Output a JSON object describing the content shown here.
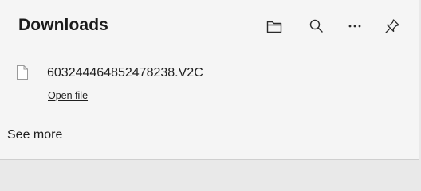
{
  "panel": {
    "title": "Downloads",
    "toolbar": [
      {
        "name": "open-downloads-folder",
        "icon": "folder-icon"
      },
      {
        "name": "search-downloads",
        "icon": "search-icon"
      },
      {
        "name": "more-options",
        "icon": "more-horizontal-icon"
      },
      {
        "name": "pin-downloads",
        "icon": "pin-icon"
      }
    ]
  },
  "downloads": [
    {
      "file_name": "603244464852478238.V2C",
      "action_label": "Open file",
      "icon": "file-icon"
    }
  ],
  "footer": {
    "see_more_label": "See more"
  }
}
